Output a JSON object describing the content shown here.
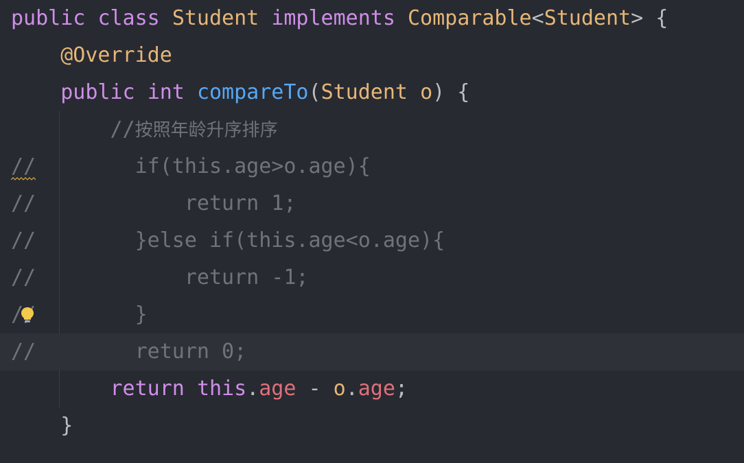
{
  "editor": {
    "lines": [
      {
        "tokens": [
          {
            "t": "public",
            "c": "kw"
          },
          {
            "t": " "
          },
          {
            "t": "class",
            "c": "kw"
          },
          {
            "t": " "
          },
          {
            "t": "Student",
            "c": "cls"
          },
          {
            "t": " "
          },
          {
            "t": "implements",
            "c": "kw"
          },
          {
            "t": " "
          },
          {
            "t": "Comparable",
            "c": "cls"
          },
          {
            "t": "<",
            "c": "punc"
          },
          {
            "t": "Student",
            "c": "cls"
          },
          {
            "t": "> {",
            "c": "punc"
          }
        ]
      },
      {
        "tokens": [
          {
            "t": "    "
          },
          {
            "t": "@Override",
            "c": "ann"
          }
        ]
      },
      {
        "tokens": [
          {
            "t": "    "
          },
          {
            "t": "public",
            "c": "kw"
          },
          {
            "t": " "
          },
          {
            "t": "int",
            "c": "kw"
          },
          {
            "t": " "
          },
          {
            "t": "compareTo",
            "c": "fn"
          },
          {
            "t": "(",
            "c": "punc"
          },
          {
            "t": "Student",
            "c": "cls"
          },
          {
            "t": " "
          },
          {
            "t": "o",
            "c": "param"
          },
          {
            "t": ") {",
            "c": "punc"
          }
        ]
      },
      {
        "tokens": [
          {
            "t": "        "
          },
          {
            "t": "//",
            "c": "cmt"
          },
          {
            "t": "按照年龄升序排序",
            "c": "cmt-text"
          }
        ]
      },
      {
        "gutter": "//",
        "squiggle": true,
        "tokens": [
          {
            "t": "          "
          },
          {
            "t": "if(this.age>o.age){",
            "c": "cmt"
          }
        ]
      },
      {
        "gutter": "//",
        "tokens": [
          {
            "t": "              "
          },
          {
            "t": "return 1;",
            "c": "cmt"
          }
        ]
      },
      {
        "gutter": "//",
        "tokens": [
          {
            "t": "          "
          },
          {
            "t": "}else if(this.age<o.age){",
            "c": "cmt"
          }
        ]
      },
      {
        "gutter": "//",
        "tokens": [
          {
            "t": "              "
          },
          {
            "t": "return -1;",
            "c": "cmt"
          }
        ]
      },
      {
        "gutter": "//",
        "bulb": true,
        "tokens": [
          {
            "t": "          "
          },
          {
            "t": "}",
            "c": "cmt"
          }
        ]
      },
      {
        "gutter": "//",
        "current": true,
        "tokens": [
          {
            "t": "          "
          },
          {
            "t": "return 0;",
            "c": "cmt"
          }
        ]
      },
      {
        "tokens": [
          {
            "t": "        "
          },
          {
            "t": "return",
            "c": "kw"
          },
          {
            "t": " "
          },
          {
            "t": "this",
            "c": "kw"
          },
          {
            "t": ".",
            "c": "punc"
          },
          {
            "t": "age",
            "c": "field"
          },
          {
            "t": " - ",
            "c": "punc"
          },
          {
            "t": "o",
            "c": "param"
          },
          {
            "t": ".",
            "c": "punc"
          },
          {
            "t": "age",
            "c": "field"
          },
          {
            "t": ";",
            "c": "punc"
          }
        ]
      },
      {
        "tokens": [
          {
            "t": "    "
          },
          {
            "t": "}",
            "c": "punc"
          }
        ]
      }
    ],
    "colors": {
      "background": "#272a31",
      "current_line": "#2e3138",
      "keyword": "#cf8ee8",
      "class": "#e6b677",
      "function": "#56a8f5",
      "field": "#e0707a",
      "comment": "#6f737a",
      "bulb": "#f2c94c"
    },
    "icons": {
      "bulb": "lightbulb-icon",
      "squiggle": "warning-squiggle-icon"
    }
  }
}
